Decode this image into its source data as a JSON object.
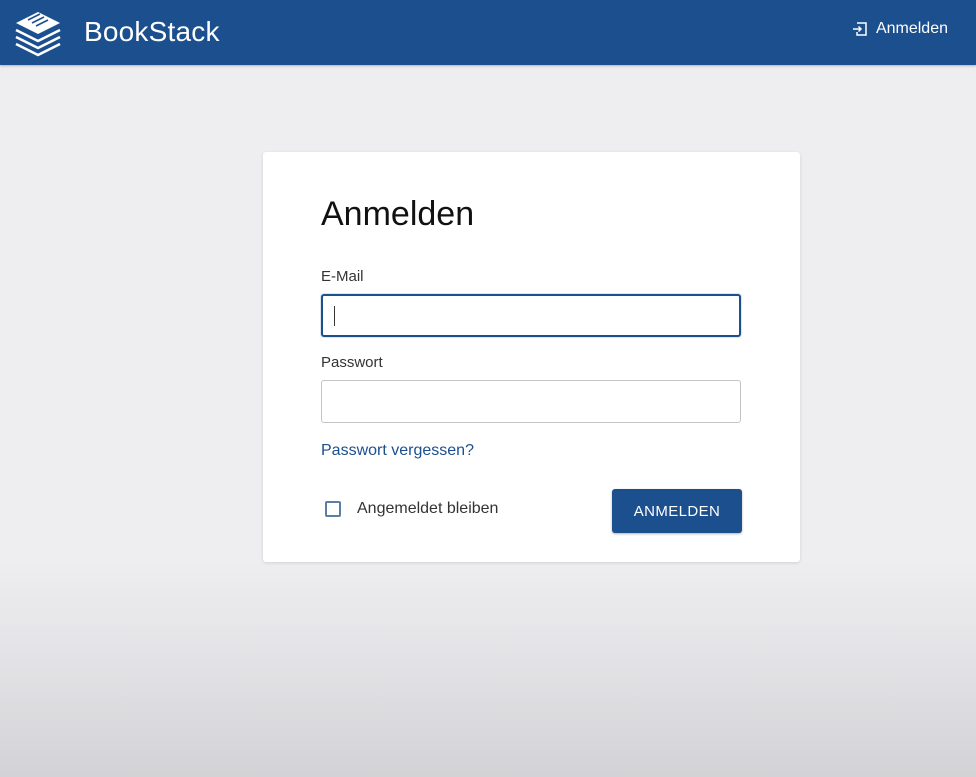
{
  "header": {
    "app_name": "BookStack",
    "logo_icon": "book-stack-icon",
    "login_icon": "login-icon",
    "login_label": "Anmelden"
  },
  "login_form": {
    "title": "Anmelden",
    "email_label": "E-Mail",
    "email_value": "",
    "password_label": "Passwort",
    "password_value": "",
    "forgot_password": "Passwort vergessen?",
    "remember_label": "Angemeldet bleiben",
    "remember_checked": false,
    "submit_label": "ANMELDEN"
  },
  "colors": {
    "primary": "#1b4f8e",
    "background": "#eeedef",
    "card": "#ffffff"
  }
}
